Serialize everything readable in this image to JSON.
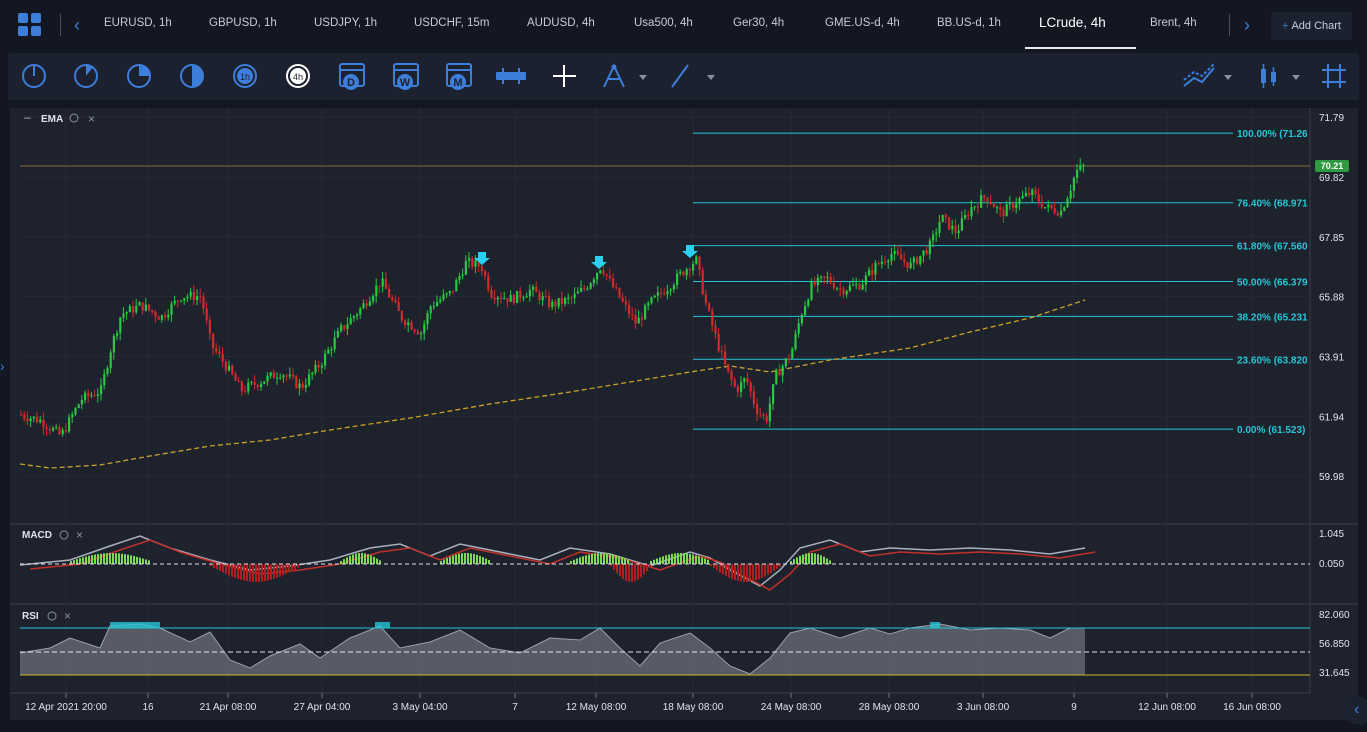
{
  "tabs": [
    {
      "label": "EURUSD, 1h"
    },
    {
      "label": "GBPUSD, 1h"
    },
    {
      "label": "USDJPY, 1h"
    },
    {
      "label": "USDCHF, 15m"
    },
    {
      "label": "AUDUSD, 4h"
    },
    {
      "label": "Usa500, 4h"
    },
    {
      "label": "Ger30, 4h"
    },
    {
      "label": "GME.US-d, 4h"
    },
    {
      "label": "BB.US-d, 1h"
    },
    {
      "label": "LCrude, 4h"
    },
    {
      "label": "Brent, 4h"
    }
  ],
  "active_tab": "LCrude, 4h",
  "add_chart_label": "Add Chart",
  "toolbar": {
    "timeframes": [
      "clock-1m-icon",
      "clock-5m-icon",
      "clock-15m-icon",
      "clock-30m-icon",
      "1h",
      "4h"
    ],
    "calendar_buttons": [
      "D",
      "W",
      "M"
    ]
  },
  "indicators": {
    "ema": "EMA",
    "macd": "MACD",
    "rsi": "RSI"
  },
  "price_axis": [
    "71.79",
    "69.82",
    "67.85",
    "65.88",
    "63.91",
    "61.94",
    "59.98"
  ],
  "current_price": "70.21",
  "macd_axis": [
    "1.045",
    "0.050"
  ],
  "rsi_axis": [
    "82.060",
    "56.850",
    "31.645"
  ],
  "fib_levels": [
    {
      "label": "100.00% (71.26",
      "price": 71.26
    },
    {
      "label": "76.40% (68.971",
      "price": 68.971
    },
    {
      "label": "61.80% (67.560",
      "price": 67.56
    },
    {
      "label": "50.00% (66.379",
      "price": 66.379
    },
    {
      "label": "38.20% (65.231",
      "price": 65.231
    },
    {
      "label": "23.60% (63.820",
      "price": 63.82
    },
    {
      "label": "0.00% (61.523)",
      "price": 61.523
    }
  ],
  "time_axis": [
    "12 Apr 2021 20:00",
    "16",
    "21 Apr 08:00",
    "27 Apr 04:00",
    "3 May 04:00",
    "7",
    "12 May 08:00",
    "18 May 08:00",
    "24 May 08:00",
    "28 May 08:00",
    "3 Jun 08:00",
    "9",
    "12 Jun 08:00",
    "16 Jun 08:00"
  ],
  "colors": {
    "background": "#131722",
    "panel": "#1e222d",
    "up": "#26c940",
    "down": "#d12b2b",
    "fib": "#24c6d6",
    "ema_line": "#c9a227",
    "accent": "#3d7edb"
  }
}
